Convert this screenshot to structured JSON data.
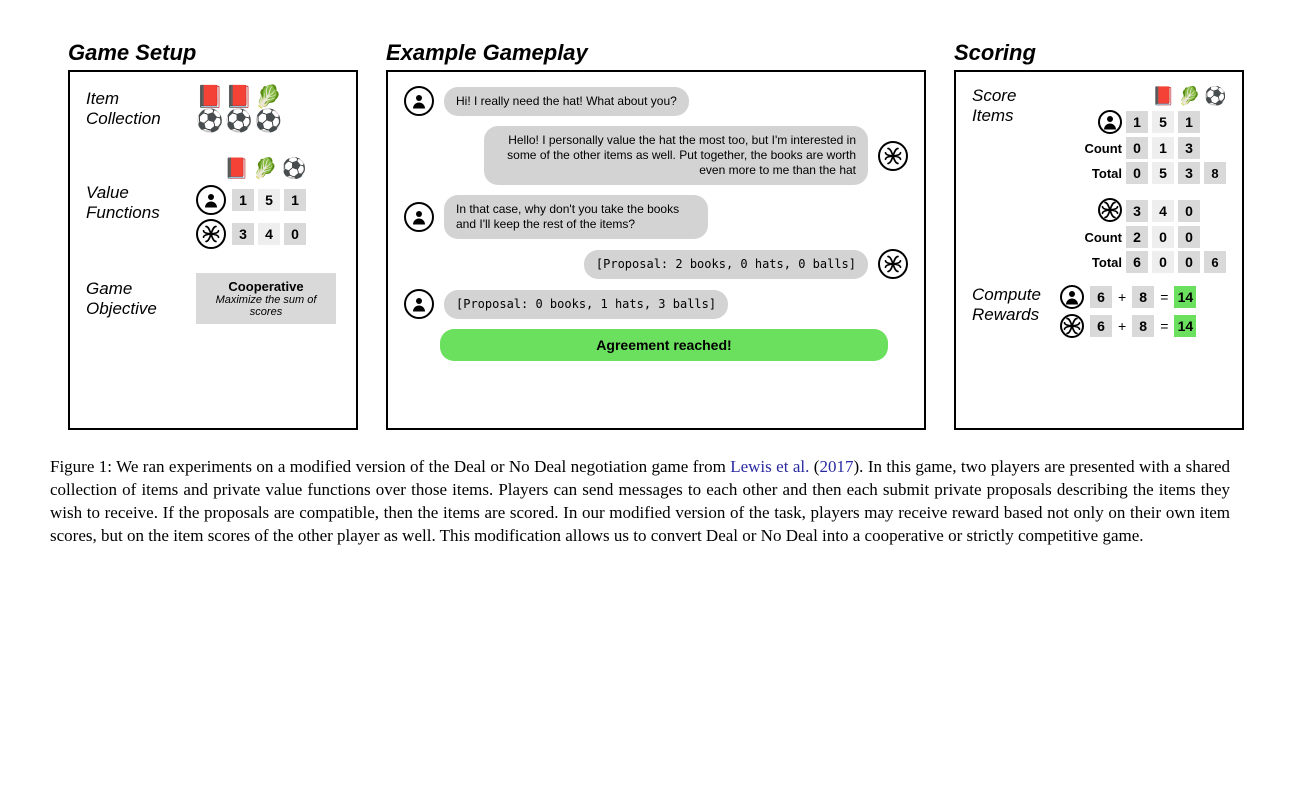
{
  "titles": {
    "setup": "Game Setup",
    "gameplay": "Example Gameplay",
    "scoring": "Scoring"
  },
  "setup": {
    "item_collection_label": "Item\nCollection",
    "items_row1": [
      "📕",
      "📕",
      "🥬"
    ],
    "items_row2": [
      "⚽",
      "⚽",
      "⚽"
    ],
    "value_functions_label": "Value\nFunctions",
    "vf_header": [
      "📕",
      "🥬",
      "⚽"
    ],
    "vf_human": [
      "1",
      "5",
      "1"
    ],
    "vf_ai": [
      "3",
      "4",
      "0"
    ],
    "game_objective_label": "Game\nObjective",
    "objective_title": "Cooperative",
    "objective_sub": "Maximize the sum of scores"
  },
  "chat": {
    "m1": "Hi! I really need the hat! What about you?",
    "m2": "Hello! I personally value the hat the most too, but I'm interested in some of the other items as well. Put together, the books are worth even more to me than the hat",
    "m3": "In that case, why don't you take the books and I'll keep the rest of the items?",
    "m4": "[Proposal: 2 books, 0 hats, 0 balls]",
    "m5": "[Proposal: 0 books, 1 hats, 3 balls]",
    "agreement": "Agreement reached!"
  },
  "scoring": {
    "score_items_label": "Score\nItems",
    "header": [
      "📕",
      "🥬",
      "⚽"
    ],
    "count_label": "Count",
    "total_label": "Total",
    "human": {
      "values": [
        "1",
        "5",
        "1"
      ],
      "counts": [
        "0",
        "1",
        "3"
      ],
      "totals": [
        "0",
        "5",
        "3"
      ],
      "sum": "8"
    },
    "ai": {
      "values": [
        "3",
        "4",
        "0"
      ],
      "counts": [
        "2",
        "0",
        "0"
      ],
      "totals": [
        "6",
        "0",
        "0"
      ],
      "sum": "6"
    },
    "compute_label": "Compute\nRewards",
    "reward_human": {
      "a": "6",
      "plus": "+",
      "b": "8",
      "eq": "=",
      "res": "14"
    },
    "reward_ai": {
      "a": "6",
      "plus": "+",
      "b": "8",
      "eq": "=",
      "res": "14"
    }
  },
  "caption": {
    "prefix": "Figure 1: We ran experiments on a modified version of the Deal or No Deal negotiation game from ",
    "link1": "Lewis et al.",
    "paren_open": " (",
    "link2": "2017",
    "paren_close": "). ",
    "body": "In this game, two players are presented with a shared collection of items and private value functions over those items. Players can send messages to each other and then each submit private proposals describing the items they wish to receive. If the proposals are compatible, then the items are scored. In our modified version of the task, players may receive reward based not only on their own item scores, but on the item scores of the other player as well. This modification allows us to convert Deal or No Deal into a cooperative or strictly competitive game."
  }
}
